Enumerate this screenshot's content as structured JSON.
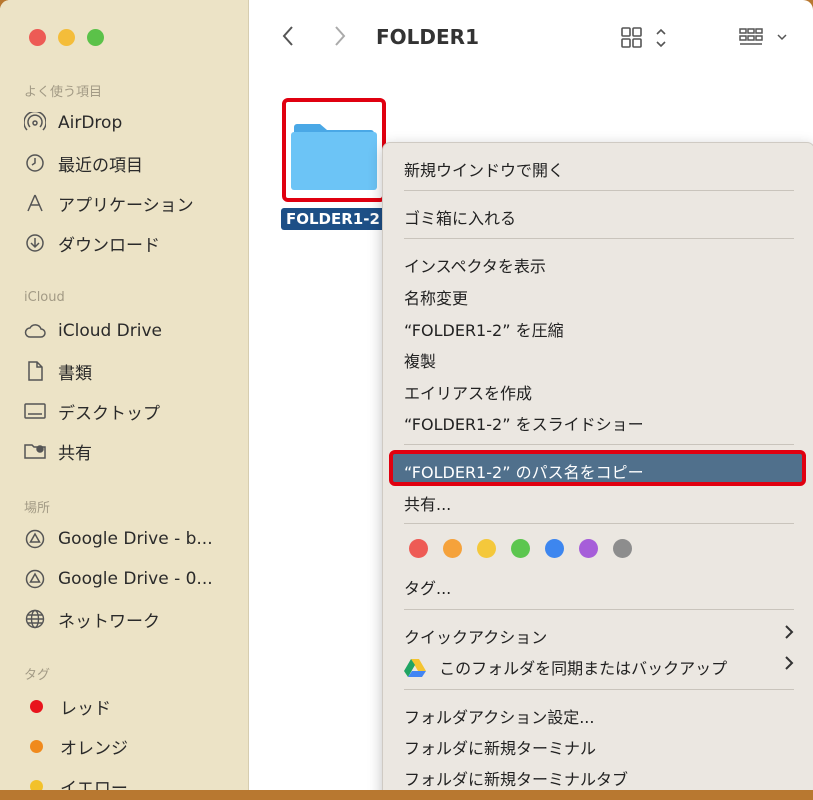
{
  "window": {
    "title": "FOLDER1"
  },
  "sidebar": {
    "sections": [
      {
        "header": "よく使う項目",
        "items": [
          {
            "label": "AirDrop",
            "icon": "airdrop-icon"
          },
          {
            "label": "最近の項目",
            "icon": "clock-icon"
          },
          {
            "label": "アプリケーション",
            "icon": "applications-icon"
          },
          {
            "label": "ダウンロード",
            "icon": "download-icon"
          }
        ]
      },
      {
        "header": "iCloud",
        "items": [
          {
            "label": "iCloud Drive",
            "icon": "cloud-icon"
          },
          {
            "label": "書類",
            "icon": "document-icon"
          },
          {
            "label": "デスクトップ",
            "icon": "desktop-icon"
          },
          {
            "label": "共有",
            "icon": "shared-folder-icon"
          }
        ]
      },
      {
        "header": "場所",
        "items": [
          {
            "label": "Google Drive - b...",
            "icon": "drive-icon"
          },
          {
            "label": "Google Drive - 0...",
            "icon": "drive-icon"
          },
          {
            "label": "ネットワーク",
            "icon": "network-icon"
          }
        ]
      },
      {
        "header": "タグ",
        "items": [
          {
            "label": "レッド",
            "color": "#e8141c"
          },
          {
            "label": "オレンジ",
            "color": "#f08a1c"
          },
          {
            "label": "イエロー",
            "color": "#f2c12a"
          }
        ]
      }
    ]
  },
  "file": {
    "name": "FOLDER1-2"
  },
  "context_menu": {
    "open_new_window": "新規ウインドウで開く",
    "move_to_trash": "ゴミ箱に入れる",
    "show_inspector": "インスペクタを表示",
    "rename": "名称変更",
    "compress": "“FOLDER1-2” を圧縮",
    "duplicate": "複製",
    "make_alias": "エイリアスを作成",
    "slideshow": "“FOLDER1-2” をスライドショー",
    "copy_path": "“FOLDER1-2” のパス名をコピー",
    "share": "共有...",
    "tag_colors": [
      "#ee5b55",
      "#f5a23b",
      "#f4c83b",
      "#5cc64f",
      "#3d86ef",
      "#a65ed9",
      "#8d8d8d"
    ],
    "tags": "タグ...",
    "quick_actions": "クイックアクション",
    "sync_backup": "このフォルダを同期またはバックアップ",
    "folder_action_settings": "フォルダアクション設定...",
    "new_terminal": "フォルダに新規ターミナル",
    "new_terminal_tab": "フォルダに新規ターミナルタブ"
  }
}
